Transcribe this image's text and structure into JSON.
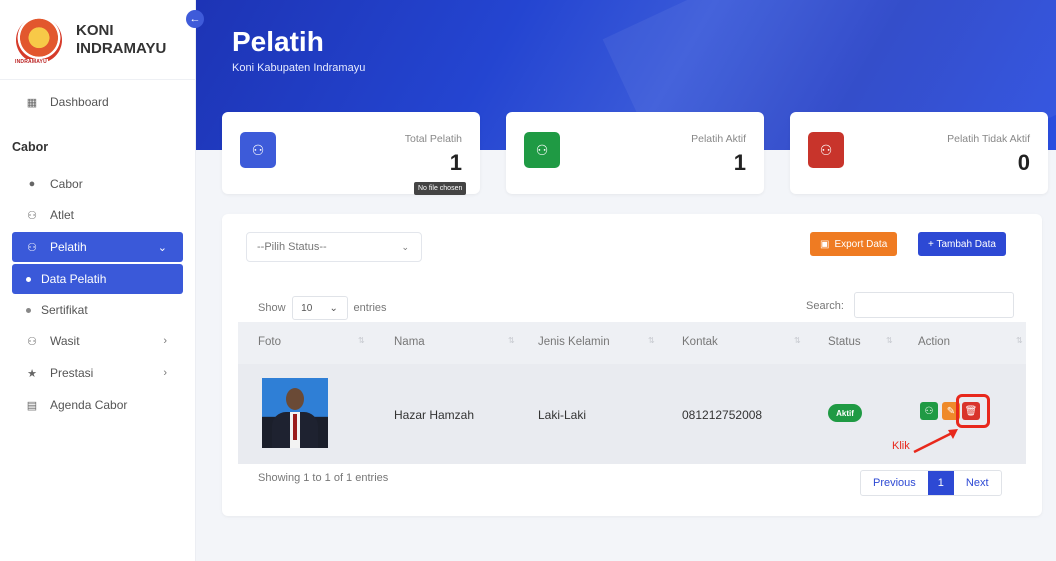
{
  "brand": {
    "line1": "KONI",
    "line2": "INDRAMAYU",
    "logo_text": "INDRAMAYU"
  },
  "sidebar": {
    "dashboard": "Dashboard",
    "section": "Cabor",
    "items": [
      {
        "label": "Cabor",
        "icon": "cabor-icon"
      },
      {
        "label": "Atlet",
        "icon": "users-icon"
      },
      {
        "label": "Pelatih",
        "icon": "users-icon"
      },
      {
        "label": "Wasit",
        "icon": "users-icon"
      },
      {
        "label": "Prestasi",
        "icon": "trophy-icon"
      },
      {
        "label": "Agenda Cabor",
        "icon": "calendar-icon"
      }
    ],
    "sub_items": [
      "Data Pelatih",
      "Sertifikat"
    ]
  },
  "header": {
    "title": "Pelatih",
    "subtitle": "Koni Kabupaten Indramayu"
  },
  "stats": [
    {
      "label": "Total Pelatih",
      "value": "1",
      "color": "#3d5bd9"
    },
    {
      "label": "Pelatih Aktif",
      "value": "1",
      "color": "#1f9a44"
    },
    {
      "label": "Pelatih Tidak Aktif",
      "value": "0",
      "color": "#c8342b"
    }
  ],
  "tooltip": "No file chosen",
  "filter": {
    "status_placeholder": "--Pilih Status--"
  },
  "buttons": {
    "export": "Export Data",
    "add": "+ Tambah Data"
  },
  "table": {
    "show_label": "Show",
    "entries_value": "10",
    "entries_label": "entries",
    "search_label": "Search:",
    "columns": [
      "Foto",
      "Nama",
      "Jenis Kelamin",
      "Kontak",
      "Status",
      "Action"
    ],
    "rows": [
      {
        "nama": "Hazar Hamzah",
        "jenis_kelamin": "Laki-Laki",
        "kontak": "081212752008",
        "status": "Aktif"
      }
    ],
    "info": "Showing 1 to 1 of 1 entries",
    "pagination": {
      "previous": "Previous",
      "current": "1",
      "next": "Next"
    }
  },
  "annotation": {
    "label": "Klik"
  }
}
